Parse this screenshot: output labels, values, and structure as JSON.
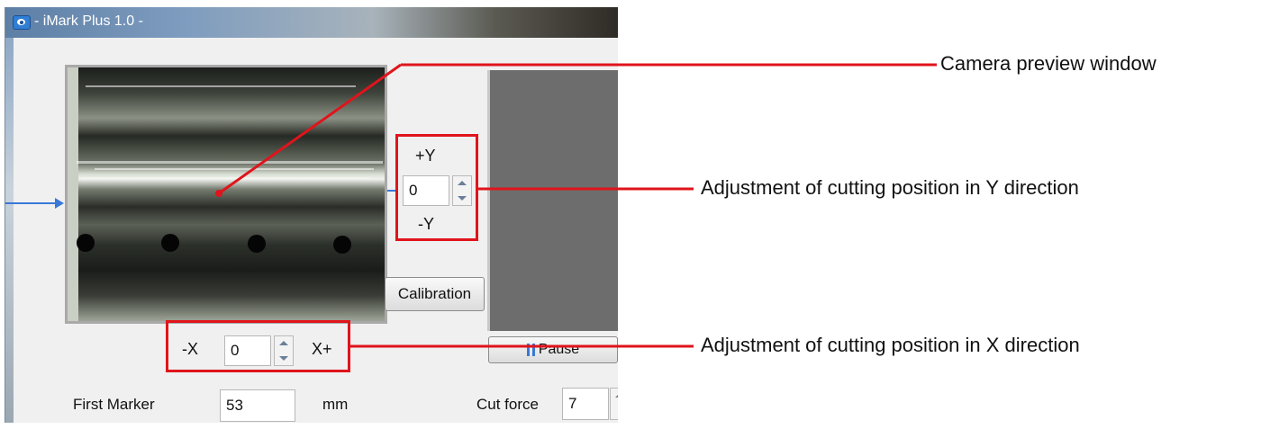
{
  "window": {
    "title": "- iMark Plus 1.0 -"
  },
  "y_adjust": {
    "plus_label": "+Y",
    "value": "0",
    "minus_label": "-Y"
  },
  "x_adjust": {
    "minus_label": "-X",
    "value": "0",
    "plus_label": "X+"
  },
  "buttons": {
    "calibration": "Calibration",
    "pause": "Pause"
  },
  "first_marker": {
    "label": "First Marker",
    "value": "53",
    "unit": "mm"
  },
  "cut_force": {
    "label": "Cut force",
    "value": "7"
  },
  "callouts": {
    "camera": "Camera preview window",
    "y": "Adjustment of cutting position in Y direction",
    "x": "Adjustment of cutting position in X direction"
  },
  "colors": {
    "callout_red": "#e0141b",
    "arrow_blue": "#3a78d6",
    "pause_icon": "#3a78d6"
  },
  "icons": [
    "app-eye-icon",
    "spin-up-icon",
    "spin-down-icon",
    "pause-icon",
    "arrow-right-icon"
  ]
}
